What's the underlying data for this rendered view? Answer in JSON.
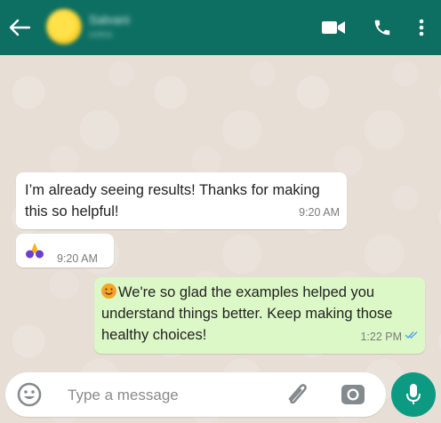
{
  "header": {
    "contact_name": "Salvani",
    "contact_status": "online",
    "back_icon": "arrow-left-icon",
    "video_icon": "video-camera-icon",
    "call_icon": "phone-icon",
    "menu_icon": "more-vertical-icon",
    "color": "#0d6f62"
  },
  "messages": [
    {
      "direction": "incoming",
      "text": "I’m already seeing results! Thanks for making this so helpful!",
      "time": "9:20 AM"
    },
    {
      "direction": "incoming",
      "text": "🙏",
      "time": "9:20 AM"
    },
    {
      "direction": "outgoing",
      "text": "We're so glad the examples helped you understand things better. Keep making those healthy choices!",
      "time": "1:22 PM",
      "status": "read"
    }
  ],
  "composer": {
    "placeholder": "Type a message",
    "value": "",
    "emoji_icon": "smiley-icon",
    "attach_icon": "paperclip-icon",
    "camera_icon": "camera-icon",
    "mic_icon": "microphone-icon",
    "mic_color": "#0d9a83"
  },
  "colors": {
    "incoming_bubble": "#ffffff",
    "outgoing_bubble": "#dcf8c6",
    "read_ticks": "#4fa6e8"
  }
}
